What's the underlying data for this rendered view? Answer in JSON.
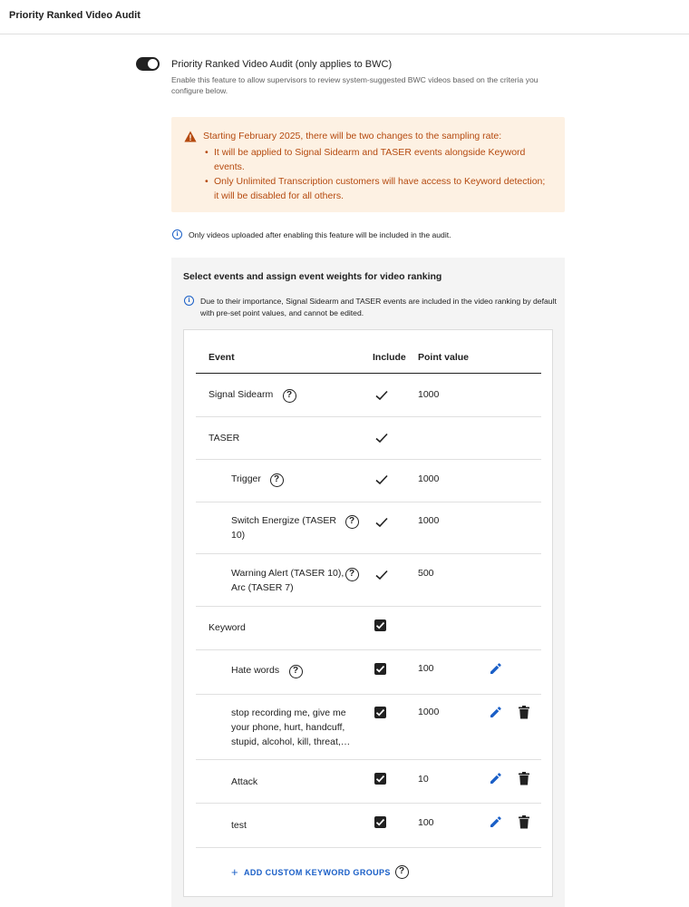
{
  "header": {
    "title": "Priority Ranked Video Audit"
  },
  "feature": {
    "toggle_on": true,
    "title": "Priority Ranked Video Audit (only applies to BWC)",
    "description": "Enable this feature to allow supervisors to review system-suggested BWC videos based on the criteria you configure below."
  },
  "warning": {
    "heading": "Starting February 2025, there will be two changes to the sampling rate:",
    "items": [
      "It will be applied to Signal Sidearm and TASER events alongside Keyword events.",
      "Only Unlimited Transcription customers will have access to Keyword detection; it will be disabled for all others."
    ],
    "color": "#b54a0f",
    "background": "#fdf1e3"
  },
  "info_note": "Only videos uploaded after enabling this feature will be included in the audit.",
  "panel": {
    "title": "Select events and assign event weights for video ranking",
    "info": "Due to their importance, Signal Sidearm and TASER events are included in the video ranking by default with pre-set point values, and cannot be edited."
  },
  "table": {
    "headers": {
      "event": "Event",
      "include": "Include",
      "points": "Point value"
    },
    "rows": [
      {
        "name": "Signal Sidearm",
        "points": "1000"
      },
      {
        "name": "TASER",
        "points": ""
      },
      {
        "name": "Trigger",
        "points": "1000"
      },
      {
        "name": "Switch Energize (TASER 10)",
        "points": "1000"
      },
      {
        "name": "Warning Alert (TASER 10), Arc (TASER 7)",
        "points": "500"
      },
      {
        "name": "Keyword",
        "points": ""
      },
      {
        "name": "Hate words",
        "points": "100"
      },
      {
        "name": "stop recording me, give me your phone, hurt, handcuff, stupid, alcohol, kill, threat,…",
        "points": "1000"
      },
      {
        "name": "Attack",
        "points": "10"
      },
      {
        "name": "test",
        "points": "100"
      }
    ]
  },
  "add_button": {
    "label": "ADD CUSTOM KEYWORD GROUPS"
  },
  "colors": {
    "accent": "#1a5fc7",
    "text": "#212121",
    "panel_bg": "#f4f4f4"
  }
}
